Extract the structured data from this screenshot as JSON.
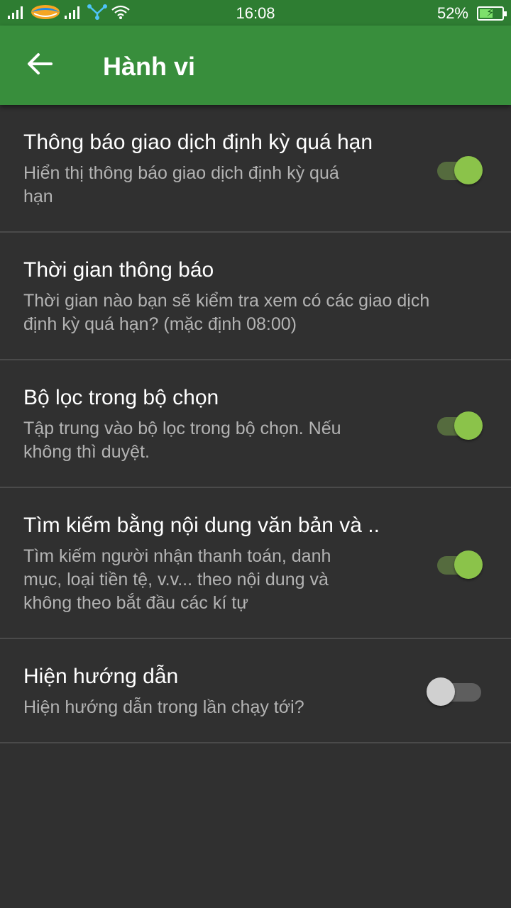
{
  "status_bar": {
    "time": "16:08",
    "battery": "52%",
    "battery_level": 0.52,
    "icons": [
      "signal-icon",
      "carrier-logo-icon",
      "signal-icon",
      "share-icon",
      "wifi-icon",
      "battery-charging-icon"
    ]
  },
  "app_bar": {
    "title": "Hành vi",
    "back_icon": "arrow-left-icon"
  },
  "prefs": [
    {
      "title": "Thông báo giao dịch định kỳ quá hạn",
      "summary_lines": [
        "Hiển thị thông báo giao dịch định kỳ quá",
        "hạn"
      ],
      "toggle": true
    },
    {
      "title": "Thời gian thông báo",
      "summary_lines": [
        "Thời gian nào bạn sẽ kiểm tra xem có các giao dịch",
        "định kỳ quá hạn? (mặc định 08:00)"
      ],
      "toggle": null
    },
    {
      "title": "Bộ lọc trong bộ chọn",
      "summary_lines": [
        "Tập trung vào bộ lọc trong bộ chọn. Nếu",
        "không thì duyệt."
      ],
      "toggle": true
    },
    {
      "title": "Tìm kiếm bằng nội dung văn bản và ..",
      "summary_lines": [
        "Tìm kiếm người nhận thanh toán, danh",
        "mục, loại tiền tệ, v.v... theo nội dung và",
        "không theo bắt đầu các kí tự"
      ],
      "toggle": true
    },
    {
      "title": "Hiện hướng dẫn",
      "summary_lines": [
        "Hiện hướng dẫn trong lần chạy tới?"
      ],
      "toggle": false
    }
  ],
  "colors": {
    "status_bar": "#2e7d32",
    "app_bar": "#388e3c",
    "background": "#303030",
    "switch_on_thumb": "#8bc34a",
    "switch_off_thumb": "#d0d0d0"
  }
}
